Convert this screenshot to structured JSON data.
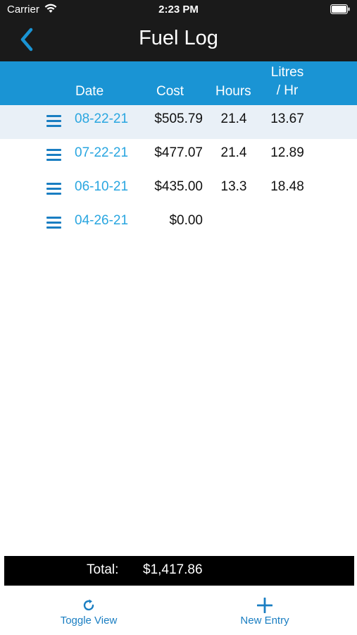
{
  "status_bar": {
    "carrier": "Carrier",
    "time": "2:23 PM"
  },
  "nav": {
    "title": "Fuel Log",
    "back_icon": "chevron-left-icon"
  },
  "columns": {
    "date": "Date",
    "cost": "Cost",
    "hours": "Hours",
    "litres_line1": "Litres",
    "litres_line2": "/ Hr"
  },
  "rows": [
    {
      "date": "08-22-21",
      "cost": "$505.79",
      "hours": "21.4",
      "litres_hr": "13.67",
      "selected": true
    },
    {
      "date": "07-22-21",
      "cost": "$477.07",
      "hours": "21.4",
      "litres_hr": "12.89",
      "selected": false
    },
    {
      "date": "06-10-21",
      "cost": "$435.00",
      "hours": "13.3",
      "litres_hr": "18.48",
      "selected": false
    },
    {
      "date": "04-26-21",
      "cost": "$0.00",
      "hours": "",
      "litres_hr": "",
      "selected": false
    }
  ],
  "total": {
    "label": "Total:",
    "value": "$1,417.86"
  },
  "toolbar": {
    "toggle_label": "Toggle View",
    "toggle_icon": "refresh-icon",
    "new_label": "New Entry",
    "new_icon": "plus-icon"
  },
  "colors": {
    "nav_background": "#1a1a1a",
    "header_background": "#1a94d4",
    "accent": "#1a7ec2",
    "date_link": "#29a6e0",
    "selected_row": "#e9f0f7"
  }
}
